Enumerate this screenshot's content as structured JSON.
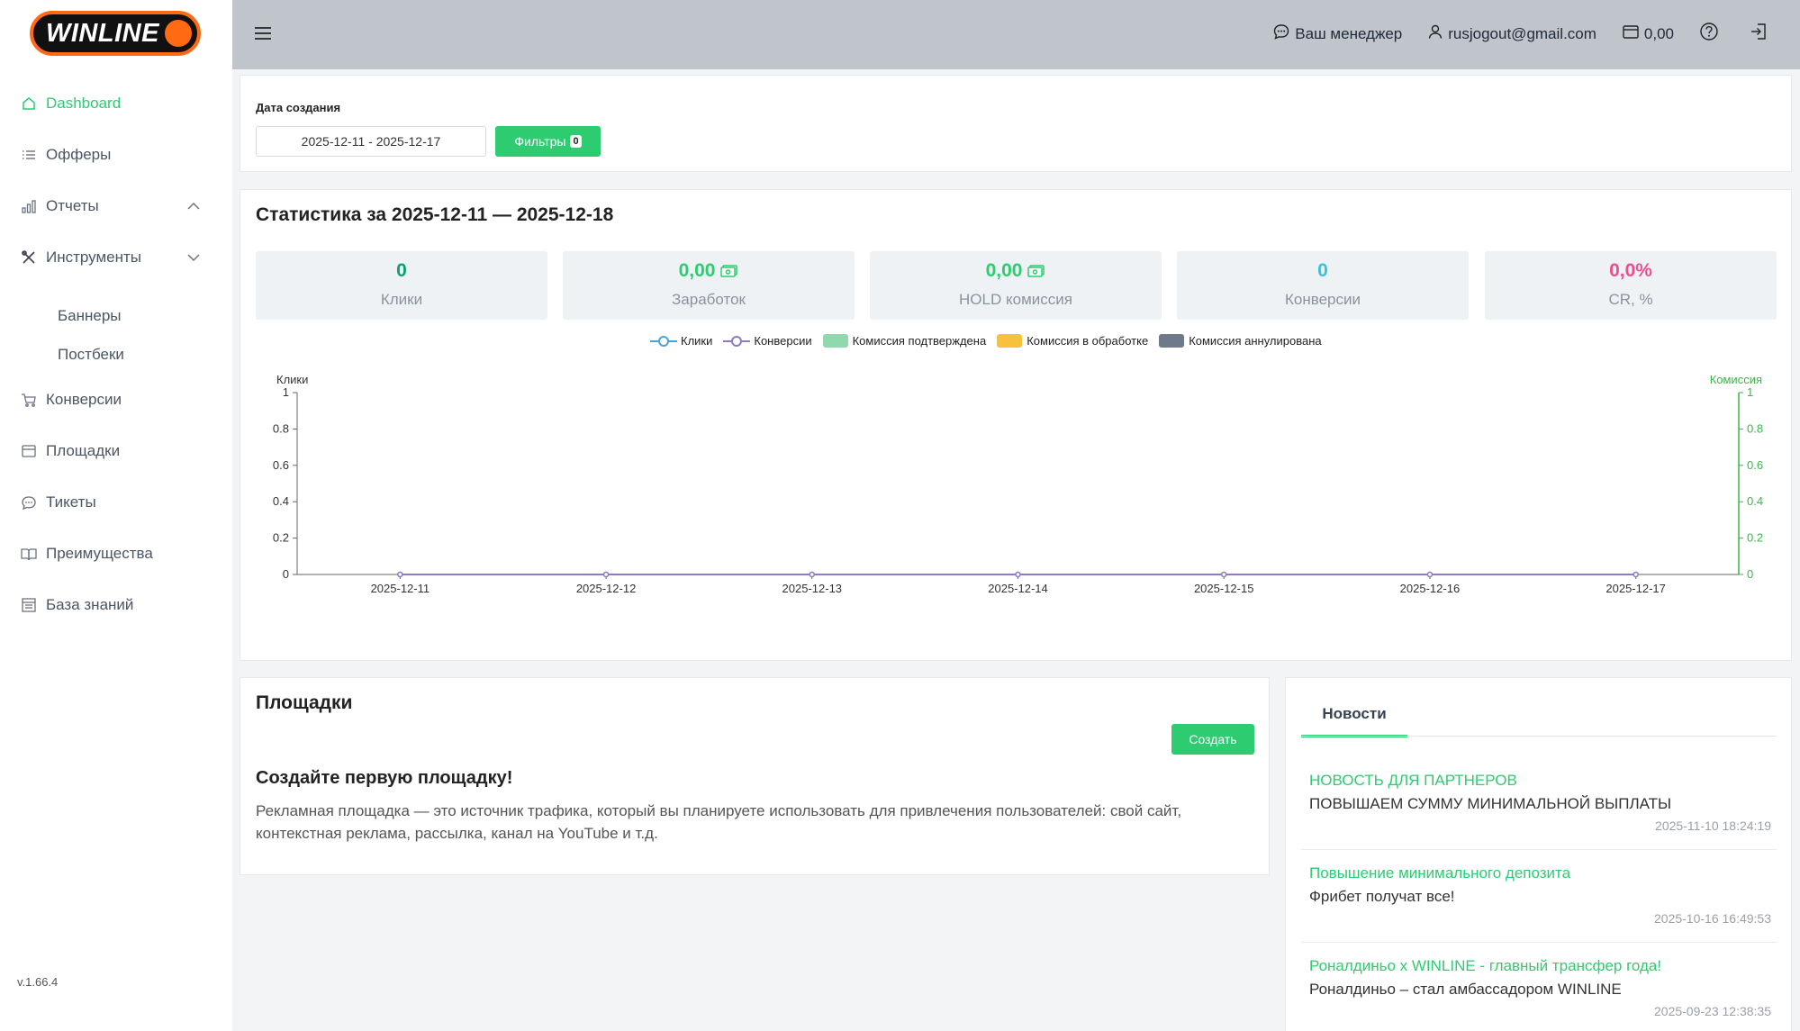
{
  "brand": {
    "logo_text": "WINLINE",
    "accent": "#2ecc71",
    "logo_color": "#ff6a13"
  },
  "sidebar": {
    "items": [
      {
        "label": "Dashboard",
        "icon": "home-icon"
      },
      {
        "label": "Офферы",
        "icon": "list-icon"
      },
      {
        "label": "Отчеты",
        "icon": "bar-chart-icon"
      },
      {
        "label": "Инструменты",
        "icon": "tools-icon"
      },
      {
        "label": "Конверсии",
        "icon": "cart-icon"
      },
      {
        "label": "Площадки",
        "icon": "window-icon"
      },
      {
        "label": "Тикеты",
        "icon": "chat-icon"
      },
      {
        "label": "Преимущества",
        "icon": "book-icon"
      },
      {
        "label": "База знаний",
        "icon": "table-icon"
      }
    ],
    "tools_sub": [
      "Баннеры",
      "Постбеки"
    ],
    "version": "v.1.66.4"
  },
  "topbar": {
    "manager": "Ваш менеджер",
    "email": "rusjogout@gmail.com",
    "balance": "0,00"
  },
  "filters": {
    "date_label": "Дата создания",
    "date_range": "2025-12-11 - 2025-12-17",
    "button_label": "Фильтры",
    "count": "0"
  },
  "stats": {
    "title": "Статистика за 2025-12-11 — 2025-12-18",
    "boxes": [
      {
        "value": "0",
        "label": "Клики",
        "color": "#0e9f6e"
      },
      {
        "value": "0,00",
        "label": "Заработок",
        "color": "#2ecc71"
      },
      {
        "value": "0,00",
        "label": "HOLD комиссия",
        "color": "#2ecc71"
      },
      {
        "value": "0",
        "label": "Конверсии",
        "color": "#3fc1d8"
      },
      {
        "value": "0,0%",
        "label": "CR, %",
        "color": "#ec4f8f"
      }
    ]
  },
  "chart_data": {
    "type": "line",
    "x": [
      "2025-12-11",
      "2025-12-12",
      "2025-12-13",
      "2025-12-14",
      "2025-12-15",
      "2025-12-16",
      "2025-12-17"
    ],
    "ylabel": "Клики",
    "y2label": "Комиссия",
    "ylim": [
      0,
      1
    ],
    "y2lim": [
      0,
      1
    ],
    "yticks": [
      "0",
      "0.2",
      "0.4",
      "0.6",
      "0.8",
      "1"
    ],
    "legend_position": "top-center",
    "series": [
      {
        "name": "Клики",
        "kind": "line",
        "color": "#4aa3df",
        "values": [
          0,
          0,
          0,
          0,
          0,
          0,
          0
        ]
      },
      {
        "name": "Конверсии",
        "kind": "line",
        "color": "#8e7cc3",
        "values": [
          0,
          0,
          0,
          0,
          0,
          0,
          0
        ]
      },
      {
        "name": "Комиссия подтверждена",
        "kind": "bar",
        "color": "#8fd9ac",
        "values": [
          0,
          0,
          0,
          0,
          0,
          0,
          0
        ]
      },
      {
        "name": "Комиссия в обработке",
        "kind": "bar",
        "color": "#f7c13c",
        "values": [
          0,
          0,
          0,
          0,
          0,
          0,
          0
        ]
      },
      {
        "name": "Комиссия аннулирована",
        "kind": "bar",
        "color": "#6e7a8a",
        "values": [
          0,
          0,
          0,
          0,
          0,
          0,
          0
        ]
      }
    ]
  },
  "sites": {
    "title": "Площадки",
    "create_label": "Создать",
    "heading": "Создайте первую площадку!",
    "description": "Рекламная площадка — это источник трафика, который вы планируете использовать для привлечения пользователей: свой сайт, контекстная реклама, рассылка, канал на YouTube и т.д."
  },
  "news": {
    "tab_label": "Новости",
    "items": [
      {
        "title": "НОВОСТЬ ДЛЯ ПАРТНЕРОВ",
        "subtitle": "ПОВЫШАЕМ СУММУ МИНИМАЛЬНОЙ ВЫПЛАТЫ",
        "date": "2025-11-10 18:24:19"
      },
      {
        "title": "Повышение минимального депозита",
        "subtitle": "Фрибет получат все!",
        "date": "2025-10-16 16:49:53"
      },
      {
        "title": "Роналдиньо х WINLINE - главный трансфер года!",
        "subtitle": "Роналдиньо – стал амбассадором WINLINE",
        "date": "2025-09-23 12:38:35"
      }
    ]
  }
}
